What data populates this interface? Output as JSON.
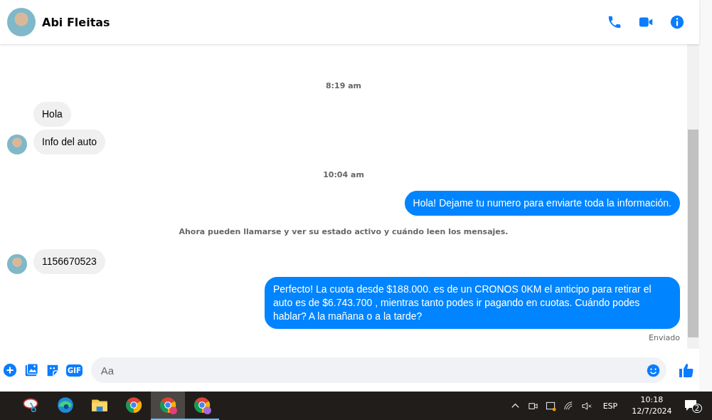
{
  "header": {
    "contact_name": "Abi Fleitas"
  },
  "messages": [
    {
      "kind": "time",
      "text": "8:19 am"
    },
    {
      "kind": "incoming",
      "text": "Hola",
      "avatar": false
    },
    {
      "kind": "incoming",
      "text": "Info del auto",
      "avatar": true
    },
    {
      "kind": "time",
      "text": "10:04 am"
    },
    {
      "kind": "outgoing",
      "text": "Hola! Dejame tu numero  para enviarte toda la información."
    },
    {
      "kind": "notice",
      "text": "Ahora pueden llamarse y ver su estado activo y cuándo leen los mensajes."
    },
    {
      "kind": "incoming",
      "text": "1156670523",
      "avatar": true
    },
    {
      "kind": "outgoing",
      "text": "Perfecto! La cuota desde $188.000. es de un CRONOS 0KM el anticipo para retirar el auto es de $6.743.700 , mientras tanto podes ir pagando en cuotas. Cuándo podes hablar? A la mañana o a la tarde?"
    }
  ],
  "status": "Enviado",
  "composer": {
    "placeholder": "Aa",
    "gif_label": "GIF"
  },
  "taskbar": {
    "apps": [
      {
        "kind": "snip",
        "open": false,
        "selected": false
      },
      {
        "kind": "edge",
        "open": false,
        "selected": false
      },
      {
        "kind": "folder",
        "open": false,
        "selected": false
      },
      {
        "kind": "chrome",
        "open": false,
        "selected": false
      },
      {
        "kind": "chrome-c",
        "open": true,
        "selected": true
      },
      {
        "kind": "chrome-p",
        "open": true,
        "selected": false
      }
    ],
    "language": "ESP",
    "time": "10:18",
    "date": "12/7/2024",
    "notification_count": "2"
  }
}
